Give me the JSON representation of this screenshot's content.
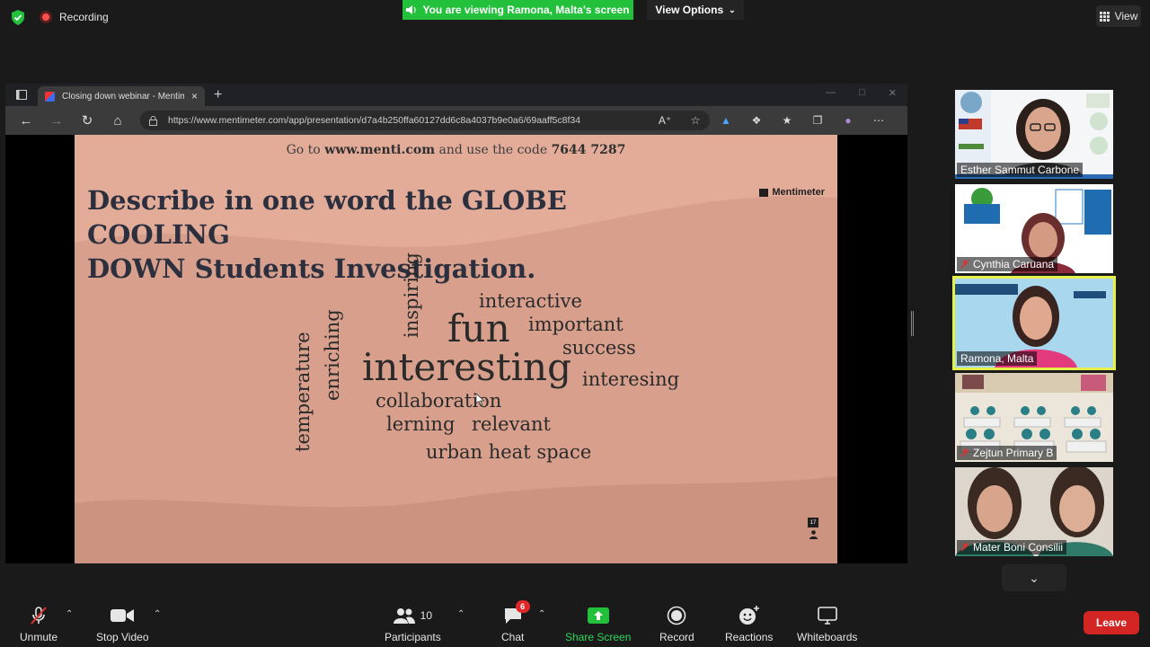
{
  "topbar": {
    "recording_label": "Recording",
    "viewing_banner": "You are viewing Ramona, Malta's screen",
    "view_options_label": "View Options",
    "view_label": "View"
  },
  "browser": {
    "tab_title": "Closing down webinar - Mentim",
    "url": "https://www.mentimeter.com/app/presentation/d7a4b250ffa60127dd6c8a4037b9e0a6/69aaff5c8f34"
  },
  "slide": {
    "code_prefix": "Go to",
    "code_site": "www.menti.com",
    "code_mid": "and use the code",
    "code_value": "7644 7287",
    "question_line1": "Describe in one word the GLOBE COOLING",
    "question_line2": "DOWN Students Investigation.",
    "brand": "Mentimeter",
    "response_count": "17",
    "words": {
      "interactive": "interactive",
      "fun": "fun",
      "important": "important",
      "success": "success",
      "interesting": "interesting",
      "interesing": "interesing",
      "collaboration": "collaboration",
      "lerning": "lerning",
      "relevant": "relevant",
      "urban": "urban heat space",
      "inspiring": "inspiring",
      "enriching": "enriching",
      "temperature": "temperature"
    }
  },
  "participants_gallery": [
    {
      "name": "Esther Sammut Carbone",
      "muted": false
    },
    {
      "name": "Cynthia Caruana",
      "muted": true
    },
    {
      "name": "Ramona, Malta",
      "muted": false
    },
    {
      "name": "Zejtun Primary B",
      "muted": true
    },
    {
      "name": "Mater Boni Consilii",
      "muted": true
    }
  ],
  "toolbar": {
    "unmute": "Unmute",
    "stop_video": "Stop Video",
    "participants": "Participants",
    "participants_count": "10",
    "chat": "Chat",
    "chat_badge": "6",
    "share_screen": "Share Screen",
    "record": "Record",
    "reactions": "Reactions",
    "whiteboards": "Whiteboards",
    "leave": "Leave"
  },
  "colors": {
    "accent_green": "#23c03c",
    "slide_bg": "#e3ac99",
    "leave_red": "#d42525",
    "active_speaker": "#e6f04a"
  }
}
